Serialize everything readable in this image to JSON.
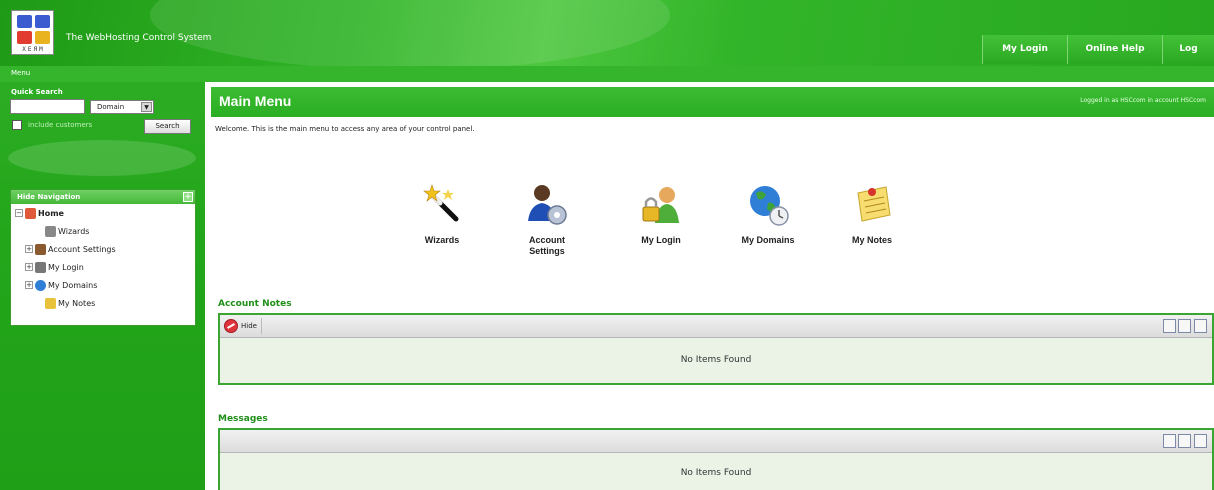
{
  "header": {
    "logo_text": "ХЕЯМ",
    "app_title": "The WebHosting Control System",
    "nav": [
      {
        "label": "My Login"
      },
      {
        "label": "Online Help"
      },
      {
        "label": "Log Out"
      }
    ]
  },
  "breadcrumb": "Menu",
  "sidebar": {
    "quick_search_title": "Quick Search",
    "search_value": "",
    "select_value": "Domain",
    "include_customers_label": "include customers",
    "search_button": "Search",
    "nav_title": "Hide Navigation",
    "tree": [
      {
        "label": "Home",
        "icon": "home-icon",
        "expander": "⊟",
        "level": 0,
        "bold": true
      },
      {
        "label": "Wizards",
        "icon": "wand-icon",
        "expander": "",
        "level": 1,
        "bold": false
      },
      {
        "label": "Account Settings",
        "icon": "users-icon",
        "expander": "⊞",
        "level": 1,
        "bold": false
      },
      {
        "label": "My Login",
        "icon": "login-icon",
        "expander": "⊞",
        "level": 1,
        "bold": false
      },
      {
        "label": "My Domains",
        "icon": "globe-icon",
        "expander": "⊞",
        "level": 1,
        "bold": false
      },
      {
        "label": "My Notes",
        "icon": "notes-icon",
        "expander": "",
        "level": 1,
        "bold": false
      }
    ]
  },
  "main": {
    "title": "Main Menu",
    "logged_in": "Logged in as HSCcom in account HSCcom",
    "welcome": "Welcome. This is the main menu to access any area of your control panel.",
    "quick_icons": [
      {
        "label": "Wizards",
        "icon": "wand-icon"
      },
      {
        "label": "Account Settings",
        "icon": "account-settings-icon"
      },
      {
        "label": "My Login",
        "icon": "login-icon"
      },
      {
        "label": "My Domains",
        "icon": "globe-icon"
      },
      {
        "label": "My Notes",
        "icon": "notes-icon"
      }
    ],
    "account_notes": {
      "title": "Account Notes",
      "hide_label": "Hide",
      "empty": "No Items Found"
    },
    "messages": {
      "title": "Messages",
      "empty": "No Items Found"
    }
  },
  "colors": {
    "brand_green": "#2aae22",
    "panel_border": "#3aa530",
    "section_title": "#1f8f19"
  }
}
